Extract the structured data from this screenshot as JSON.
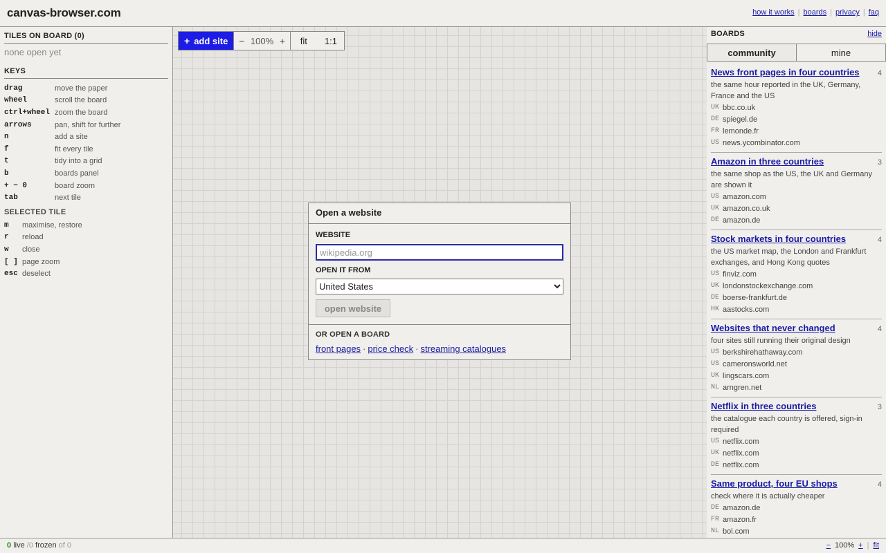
{
  "header": {
    "logo": "canvas-browser.com",
    "links": [
      "how it works",
      "boards",
      "privacy",
      "faq"
    ]
  },
  "left": {
    "tiles_title": "TILES ON BOARD (0)",
    "none_open": "none open yet",
    "keys_title": "KEYS",
    "keys": [
      {
        "k": "drag",
        "d": "move the paper"
      },
      {
        "k": "wheel",
        "d": "scroll the board"
      },
      {
        "k": "ctrl+wheel",
        "d": "zoom the board"
      },
      {
        "k": "arrows",
        "d": "pan, shift for further"
      },
      {
        "k": "n",
        "d": "add a site"
      },
      {
        "k": "f",
        "d": "fit every tile"
      },
      {
        "k": "t",
        "d": "tidy into a grid"
      },
      {
        "k": "b",
        "d": "boards panel"
      },
      {
        "k": "+ − 0",
        "d": "board zoom"
      },
      {
        "k": "tab",
        "d": "next tile"
      }
    ],
    "selected_title": "SELECTED TILE",
    "selected": [
      {
        "k": "m",
        "d": "maximise, restore"
      },
      {
        "k": "r",
        "d": "reload"
      },
      {
        "k": "w",
        "d": "close"
      },
      {
        "k": "[ ]",
        "d": "page zoom"
      },
      {
        "k": "esc",
        "d": "deselect"
      }
    ]
  },
  "toolbar": {
    "add_site": "add site",
    "zoom_out": "−",
    "zoom_level": "100%",
    "zoom_in": "+",
    "fit": "fit",
    "one_to_one": "1:1"
  },
  "modal": {
    "title": "Open a website",
    "website_label": "WEBSITE",
    "website_placeholder": "wikipedia.org",
    "open_from_label": "OPEN IT FROM",
    "country_selected": "United States",
    "open_button": "open website",
    "or_board_label": "OR OPEN A BOARD",
    "board_links": [
      "front pages",
      "price check",
      "streaming catalogues"
    ]
  },
  "boards_panel": {
    "title": "BOARDS",
    "hide": "hide",
    "tabs": [
      "community",
      "mine"
    ],
    "boards": [
      {
        "title": "News front pages in four countries",
        "count": "4",
        "desc": "the same hour reported in the UK, Germany, France and the US",
        "sites": [
          {
            "cc": "UK",
            "site": "bbc.co.uk"
          },
          {
            "cc": "DE",
            "site": "spiegel.de"
          },
          {
            "cc": "FR",
            "site": "lemonde.fr"
          },
          {
            "cc": "US",
            "site": "news.ycombinator.com"
          }
        ]
      },
      {
        "title": "Amazon in three countries",
        "count": "3",
        "desc": "the same shop as the US, the UK and Germany are shown it",
        "sites": [
          {
            "cc": "US",
            "site": "amazon.com"
          },
          {
            "cc": "UK",
            "site": "amazon.co.uk"
          },
          {
            "cc": "DE",
            "site": "amazon.de"
          }
        ]
      },
      {
        "title": "Stock markets in four countries",
        "count": "4",
        "desc": "the US market map, the London and Frankfurt exchanges, and Hong Kong quotes",
        "sites": [
          {
            "cc": "US",
            "site": "finviz.com"
          },
          {
            "cc": "UK",
            "site": "londonstockexchange.com"
          },
          {
            "cc": "DE",
            "site": "boerse-frankfurt.de"
          },
          {
            "cc": "HK",
            "site": "aastocks.com"
          }
        ]
      },
      {
        "title": "Websites that never changed",
        "count": "4",
        "desc": "four sites still running their original design",
        "sites": [
          {
            "cc": "US",
            "site": "berkshirehathaway.com"
          },
          {
            "cc": "US",
            "site": "cameronsworld.net"
          },
          {
            "cc": "UK",
            "site": "lingscars.com"
          },
          {
            "cc": "NL",
            "site": "arngren.net"
          }
        ]
      },
      {
        "title": "Netflix in three countries",
        "count": "3",
        "desc": "the catalogue each country is offered, sign-in required",
        "sites": [
          {
            "cc": "US",
            "site": "netflix.com"
          },
          {
            "cc": "UK",
            "site": "netflix.com"
          },
          {
            "cc": "DE",
            "site": "netflix.com"
          }
        ]
      },
      {
        "title": "Same product, four EU shops",
        "count": "4",
        "desc": "check where it is actually cheaper",
        "sites": [
          {
            "cc": "DE",
            "site": "amazon.de"
          },
          {
            "cc": "FR",
            "site": "amazon.fr"
          },
          {
            "cc": "NL",
            "site": "bol.com"
          }
        ]
      }
    ]
  },
  "footer": {
    "live_count": "0",
    "live_label": "live",
    "frozen_part": "/0",
    "frozen_label": "frozen",
    "of_label": "of 0",
    "zoom_out": "−",
    "zoom_level": "100%",
    "zoom_in": "+",
    "fit": "fit"
  }
}
